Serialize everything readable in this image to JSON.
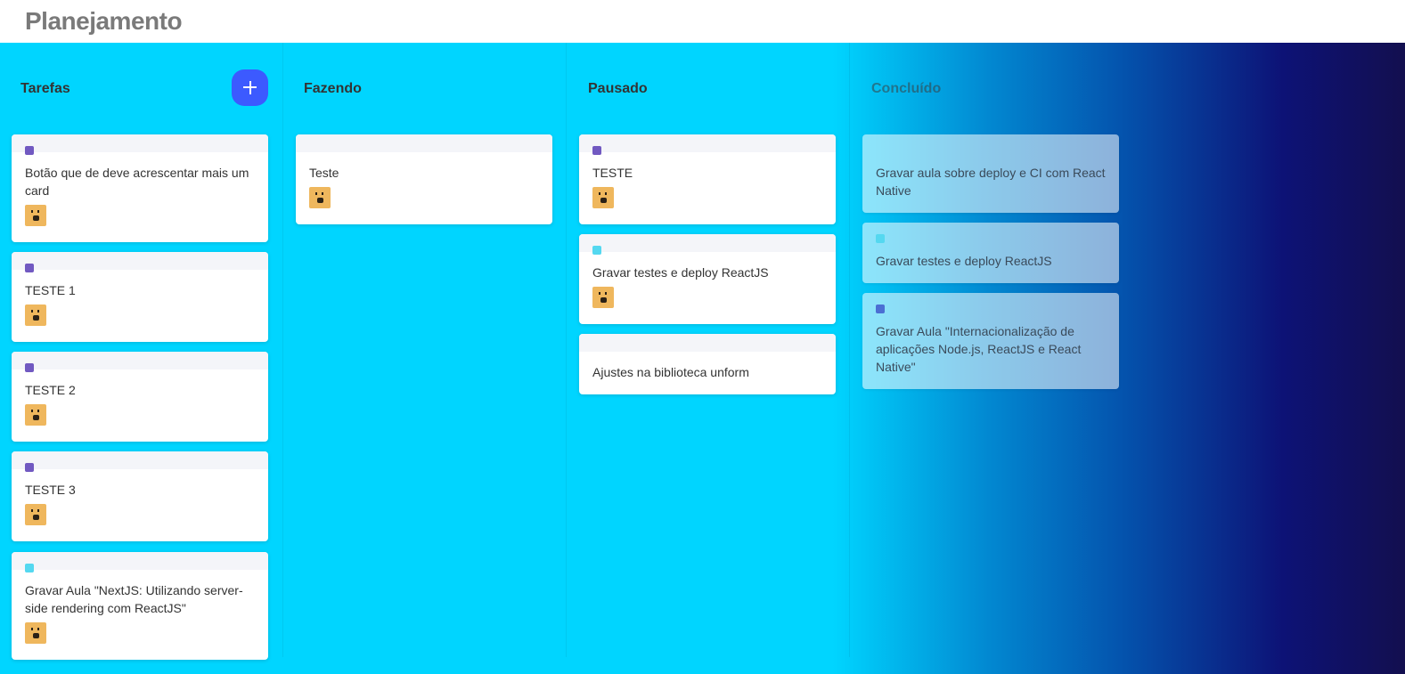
{
  "header": {
    "title": "Planejamento"
  },
  "colors": {
    "label_purple": "#7159c1",
    "label_cyan": "#54d8f0",
    "label_blue": "#4b6fd3",
    "add_button": "#3c5aff",
    "board_start": "#00d5ff",
    "board_end": "#130f4f"
  },
  "columns": [
    {
      "title": "Tarefas",
      "cards": [
        {
          "text": "Botão que de deve acrescentar mais um card",
          "label": "purple",
          "avatar": true
        },
        {
          "text": "TESTE 1",
          "label": "purple",
          "avatar": true
        },
        {
          "text": "TESTE 2",
          "label": "purple",
          "avatar": true
        },
        {
          "text": "TESTE 3",
          "label": "purple",
          "avatar": true
        },
        {
          "text": "Gravar Aula \"NextJS: Utilizando server-side rendering com ReactJS\"",
          "label": "cyan",
          "avatar": true
        }
      ]
    },
    {
      "title": "Fazendo",
      "cards": [
        {
          "text": "Teste",
          "label": "none",
          "avatar": true
        }
      ]
    },
    {
      "title": "Pausado",
      "cards": [
        {
          "text": "TESTE",
          "label": "purple",
          "avatar": true
        },
        {
          "text": "Gravar testes e deploy ReactJS",
          "label": "cyan",
          "avatar": true
        },
        {
          "text": "Ajustes na biblioteca unform",
          "label": "none",
          "avatar": false
        }
      ]
    },
    {
      "title": "Concluído",
      "cards": [
        {
          "text": "Gravar aula sobre deploy e CI com React Native",
          "label": "none",
          "avatar": false
        },
        {
          "text": "Gravar testes e deploy ReactJS",
          "label": "cyan",
          "avatar": false
        },
        {
          "text": "Gravar Aula \"Internacionalização de aplicações Node.js, ReactJS e React Native\"",
          "label": "blue",
          "avatar": false
        }
      ]
    }
  ]
}
